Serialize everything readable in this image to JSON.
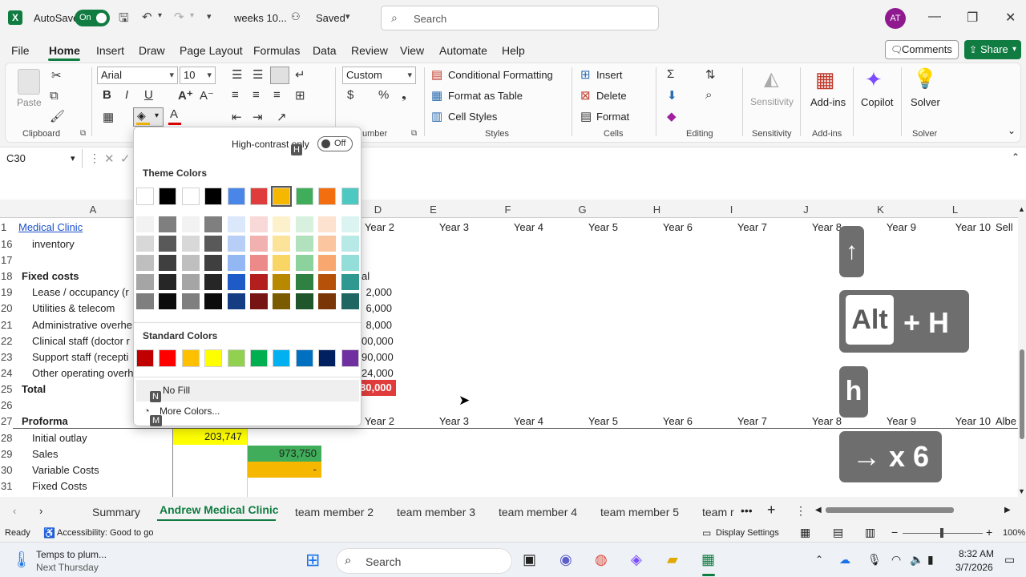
{
  "titlebar": {
    "autosave_label": "AutoSave",
    "autosave_state": "On",
    "doc_title": "weeks 10...",
    "saved": "Saved",
    "search_placeholder": "Search",
    "avatar": "AT"
  },
  "menu": [
    "File",
    "Home",
    "Insert",
    "Draw",
    "Page Layout",
    "Formulas",
    "Data",
    "Review",
    "View",
    "Automate",
    "Help"
  ],
  "menu_active": "Home",
  "comments_label": "Comments",
  "share_label": "Share",
  "ribbon": {
    "paste": "Paste",
    "clipboard": "Clipboard",
    "font_name": "Arial",
    "font_size": "10",
    "number_format": "Custom",
    "number_group": "umber",
    "conditional_formatting": "Conditional Formatting",
    "format_as_table": "Format as Table",
    "cell_styles": "Cell Styles",
    "styles": "Styles",
    "insert": "Insert",
    "delete": "Delete",
    "format": "Format",
    "cells": "Cells",
    "editing": "Editing",
    "sensitivity": "Sensitivity",
    "addins": "Add-ins",
    "copilot": "Copilot",
    "solver": "Solver"
  },
  "namebox": "C30",
  "columns": [
    "A",
    "E",
    "F",
    "G",
    "H",
    "I",
    "J",
    "K",
    "L"
  ],
  "row_numbers": [
    "1",
    "16",
    "17",
    "18",
    "19",
    "20",
    "21",
    "22",
    "23",
    "24",
    "25",
    "26",
    "27",
    "28",
    "29",
    "30",
    "31"
  ],
  "cells": {
    "a1": "Medical Clinic",
    "a16": "inventory",
    "a18": "Fixed costs",
    "a19": "Lease / occupancy (r",
    "a20": "Utilities & telecom",
    "a21": "Administrative overhe",
    "a22": "Clinical staff (doctor r",
    "a23": "Support staff (recepti",
    "a24": "Other operating overh",
    "a25": "Total",
    "a27": "Proforma",
    "a28": "Initial outlay",
    "a29": "Sales",
    "a30": "Variable Costs",
    "a31": "Fixed Costs",
    "b28": "203,747",
    "c29": "973,750",
    "c30": "-",
    "d18": "al",
    "d19": "2,000",
    "d20": "6,000",
    "d21": "8,000",
    "d22": "00,000",
    "d23": "90,000",
    "d24": "24,000",
    "d25": "80,000",
    "year_headers_row1": [
      "Year 2",
      "Year 3",
      "Year 4",
      "Year 5",
      "Year 6",
      "Year 7",
      "Year 8",
      "Year 9",
      "Year 10",
      "Sell"
    ],
    "year_headers_row27": [
      "Year 2",
      "Year 3",
      "Year 4",
      "Year 5",
      "Year 6",
      "Year 7",
      "Year 8",
      "Year 9",
      "Year 10",
      "Albe"
    ]
  },
  "fill_menu": {
    "high_contrast": "High-contrast only",
    "toggle": "Off",
    "keytip_h": "H",
    "theme_colors": "Theme Colors",
    "standard_colors": "Standard Colors",
    "no_fill": "No Fill",
    "keytip_n": "N",
    "more_colors": "More Colors...",
    "keytip_m": "M",
    "theme_top": [
      "#ffffff",
      "#000000",
      "#ffffff",
      "#000000",
      "#4a86e8",
      "#e03c3c",
      "#f6b700",
      "#3fad59",
      "#f36e0f",
      "#4ec9c2"
    ],
    "theme_shades": [
      [
        "#f2f2f2",
        "#7f7f7f",
        "#f2f2f2",
        "#7f7f7f",
        "#dbe7fb",
        "#f9d8d8",
        "#fdf1cc",
        "#d8f0de",
        "#fde2cf",
        "#dbf4f2"
      ],
      [
        "#d8d8d8",
        "#595959",
        "#d8d8d8",
        "#595959",
        "#b7cff7",
        "#f2b1b1",
        "#fbe399",
        "#b2e1bd",
        "#fbc59f",
        "#b7e9e6"
      ],
      [
        "#bfbfbf",
        "#3f3f3f",
        "#bfbfbf",
        "#3f3f3f",
        "#93b7f3",
        "#ec8a8a",
        "#f9d566",
        "#8bd29c",
        "#f8a86f",
        "#93ded9"
      ],
      [
        "#a5a5a5",
        "#262626",
        "#a5a5a5",
        "#262626",
        "#1e5bc6",
        "#b31f1f",
        "#b88900",
        "#2e8142",
        "#b6510a",
        "#2f9891"
      ],
      [
        "#7f7f7f",
        "#0c0c0c",
        "#7f7f7f",
        "#0c0c0c",
        "#143d84",
        "#771515",
        "#7b5b00",
        "#1f562c",
        "#7a3607",
        "#1f6561"
      ]
    ],
    "standard": [
      "#c00000",
      "#ff0000",
      "#ffc000",
      "#ffff00",
      "#92d050",
      "#00b050",
      "#00b0f0",
      "#0070c0",
      "#002060",
      "#7030a0"
    ]
  },
  "sheet_tabs": [
    "Summary",
    "Andrew Medical Clinic",
    "team member 2",
    "team member 3",
    "team member 4",
    "team member 5",
    "team r"
  ],
  "sheet_active": "Andrew Medical Clinic",
  "status": {
    "ready": "Ready",
    "accessibility": "Accessibility: Good to go",
    "display_settings": "Display Settings",
    "zoom": "100%"
  },
  "taskbar": {
    "weather_line1": "Temps to plum...",
    "weather_line2": "Next Thursday",
    "search": "Search",
    "time": "8:32 AM",
    "date": "3/7/2026"
  },
  "key_overlays": [
    "↑",
    "Alt",
    "+ H",
    "h",
    "→ x 6"
  ]
}
